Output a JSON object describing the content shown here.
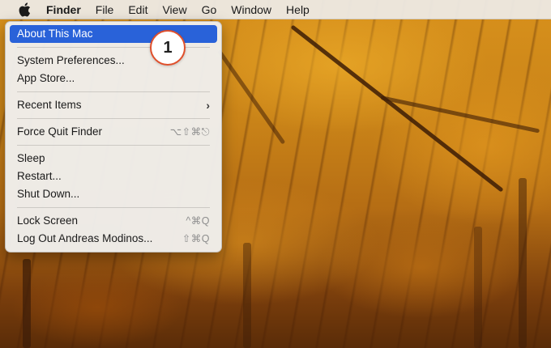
{
  "menubar": {
    "apple_icon": "apple-logo-icon",
    "items": [
      "Finder",
      "File",
      "Edit",
      "View",
      "Go",
      "Window",
      "Help"
    ]
  },
  "apple_menu": {
    "items": [
      {
        "label": "About This Mac",
        "selected": true
      },
      {
        "label": "System Preferences..."
      },
      {
        "label": "App Store..."
      },
      {
        "label": "Recent Items",
        "submenu_icon": "chevron-right-icon"
      },
      {
        "label": "Force Quit Finder",
        "shortcut": "⌥⇧⌘⎋"
      },
      {
        "label": "Sleep"
      },
      {
        "label": "Restart..."
      },
      {
        "label": "Shut Down..."
      },
      {
        "label": "Lock Screen",
        "shortcut": "^⌘Q"
      },
      {
        "label": "Log Out Andreas Modinos...",
        "shortcut": "⇧⌘Q"
      }
    ]
  },
  "badge": {
    "text": "1"
  },
  "colors": {
    "selection": "#2962d9",
    "badge_border": "#e0502c"
  }
}
